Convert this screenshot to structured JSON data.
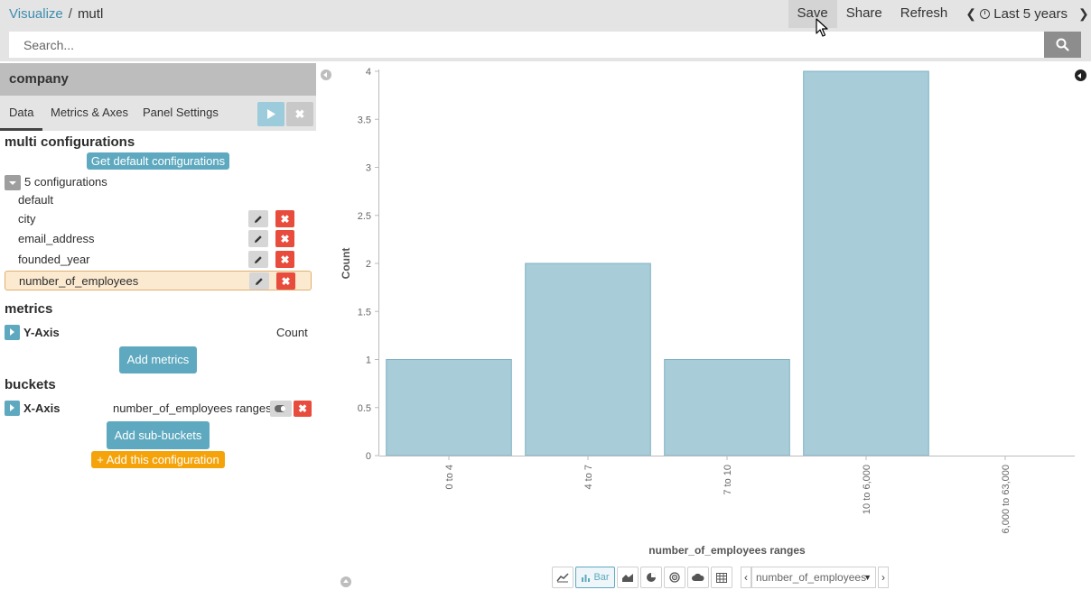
{
  "topbar": {
    "crumb_root": "Visualize",
    "crumb_sep": "/",
    "crumb_current": "mutl",
    "save": "Save",
    "share": "Share",
    "refresh": "Refresh",
    "time_range": "Last 5 years"
  },
  "search": {
    "placeholder": "Search..."
  },
  "panel": {
    "index_pattern": "company",
    "tabs": [
      "Data",
      "Metrics & Axes",
      "Panel Settings"
    ],
    "multi_title": "multi configurations",
    "get_default": "Get default configurations",
    "config_count": "5 configurations",
    "configs": [
      "default",
      "city",
      "email_address",
      "founded_year",
      "number_of_employees"
    ],
    "metrics_title": "metrics",
    "y_axis_label": "Y-Axis",
    "y_axis_agg": "Count",
    "add_metrics": "Add metrics",
    "buckets_title": "buckets",
    "x_axis_label": "X-Axis",
    "x_axis_agg": "number_of_employees ranges",
    "add_sub_buckets": "Add sub-buckets",
    "add_config": "+ Add this configuration"
  },
  "vis_toolbar": {
    "bar_label": "Bar",
    "agg_select": "number_of_employees"
  },
  "colors": {
    "bar": "#a8ccd8",
    "bar_stroke": "#7fb2c4",
    "accent": "#5ea9bf"
  },
  "chart_data": {
    "type": "bar",
    "categories": [
      "0 to 4",
      "4 to 7",
      "7 to 10",
      "10 to 6,000",
      "6,000 to 63,000"
    ],
    "values": [
      1,
      2,
      1,
      4,
      0
    ],
    "xlabel": "number_of_employees ranges",
    "ylabel": "Count",
    "ylim": [
      0,
      4
    ],
    "yticks": [
      "0",
      "0.5",
      "1",
      "1.5",
      "2",
      "2.5",
      "3",
      "3.5",
      "4"
    ],
    "grid": false,
    "legend": "none"
  }
}
